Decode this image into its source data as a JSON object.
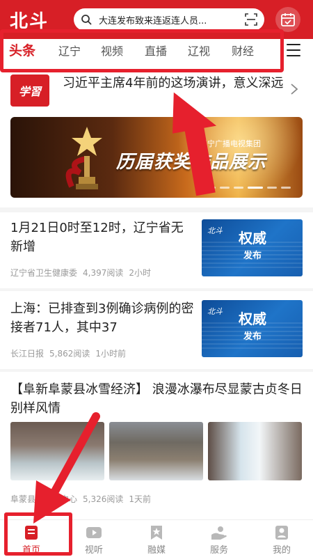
{
  "header": {
    "logo": "北斗",
    "search_text": "大连发布致来连返连人员...",
    "accent": "#d71f26"
  },
  "tabs": [
    {
      "label": "头条"
    },
    {
      "label": "辽宁"
    },
    {
      "label": "视频"
    },
    {
      "label": "直播"
    },
    {
      "label": "辽视"
    },
    {
      "label": "财经"
    }
  ],
  "study": {
    "icon_text": "学習",
    "title": "习近平主席4年前的这场演讲，意义深远"
  },
  "banner": {
    "title": "历届获奖作品展示",
    "subtitle": "辽宁广播电视集团"
  },
  "news": [
    {
      "title": "1月21日0时至12时，辽宁省无新增",
      "source": "辽宁省卫生健康委",
      "reads": "4,397阅读",
      "time": "2小时",
      "thumb_sig": "北斗",
      "thumb_b1": "权威",
      "thumb_b2": "发布"
    },
    {
      "title": "上海：已排查到3例确诊病例的密接者71人，其中37",
      "source": "长江日报",
      "reads": "5,862阅读",
      "time": "1小时前",
      "thumb_sig": "北斗",
      "thumb_b1": "权威",
      "thumb_b2": "发布"
    },
    {
      "title": "【阜新阜蒙县冰雪经济】 浪漫冰瀑布尽显蒙古贞冬日别样风情",
      "source": "阜蒙县融媒体中心",
      "reads": "5,326阅读",
      "time": "1天前"
    }
  ],
  "bottom_nav": [
    {
      "label": "首页",
      "icon": "home-icon"
    },
    {
      "label": "视听",
      "icon": "video-icon"
    },
    {
      "label": "融媒",
      "icon": "bookmark-star-icon"
    },
    {
      "label": "服务",
      "icon": "service-hand-icon"
    },
    {
      "label": "我的",
      "icon": "profile-icon"
    }
  ]
}
